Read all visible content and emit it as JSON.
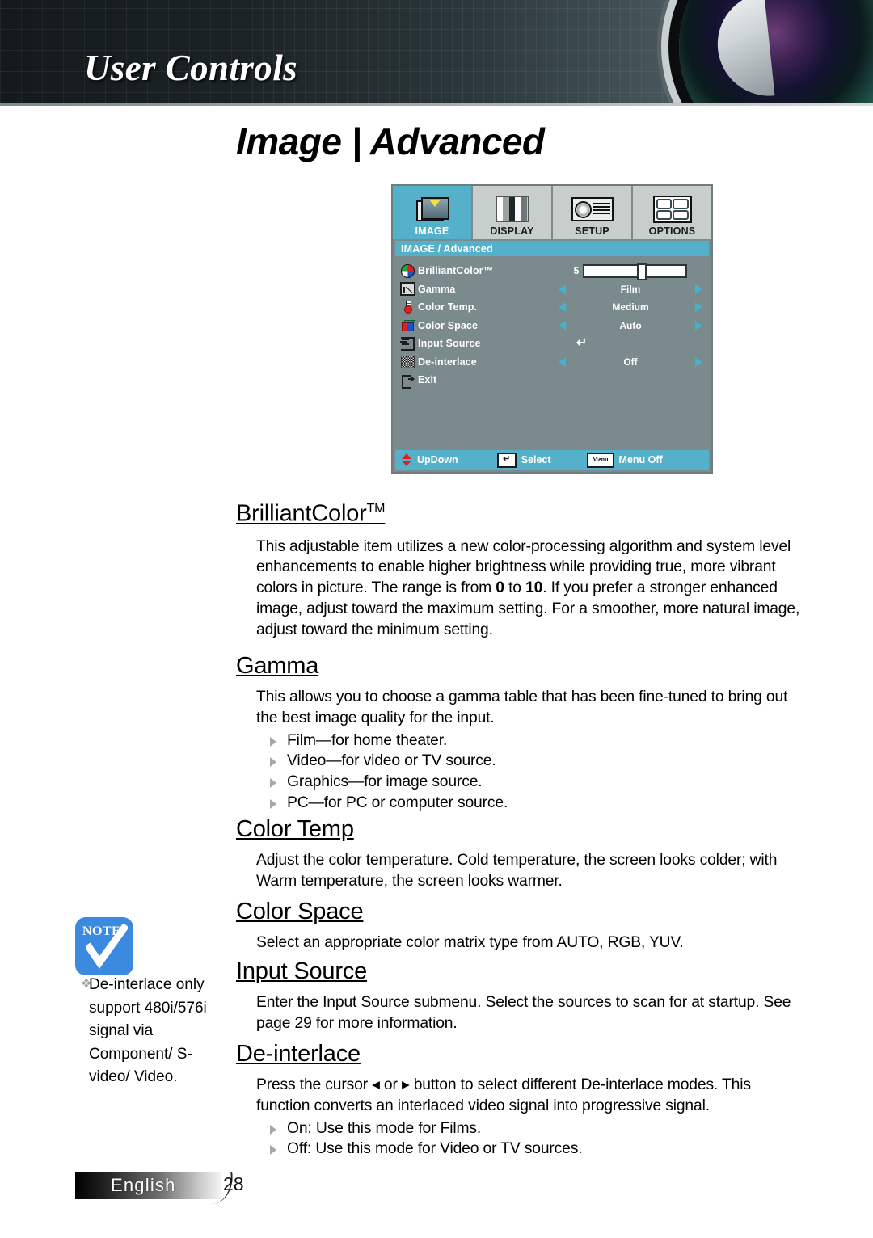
{
  "banner": {
    "title": "User Controls"
  },
  "page": {
    "title": "Image | Advanced"
  },
  "osd": {
    "tabs": [
      {
        "label": "IMAGE",
        "icon": "image-icon",
        "active": true
      },
      {
        "label": "DISPLAY",
        "icon": "display-icon",
        "active": false
      },
      {
        "label": "SETUP",
        "icon": "setup-icon",
        "active": false
      },
      {
        "label": "OPTIONS",
        "icon": "options-icon",
        "active": false
      }
    ],
    "breadcrumb": "IMAGE / Advanced",
    "rows": [
      {
        "label": "BrilliantColor™",
        "icon": "color-wheel-icon",
        "type": "slider",
        "value": "5"
      },
      {
        "label": "Gamma",
        "icon": "gamma-curve-icon",
        "type": "select",
        "value": "Film"
      },
      {
        "label": "Color Temp.",
        "icon": "thermometer-icon",
        "type": "select",
        "value": "Medium"
      },
      {
        "label": "Color Space",
        "icon": "rgb-cube-icon",
        "type": "select",
        "value": "Auto"
      },
      {
        "label": "Input Source",
        "icon": "input-arrow-icon",
        "type": "enter",
        "value": "↵"
      },
      {
        "label": "De-interlace",
        "icon": "dither-icon",
        "type": "select",
        "value": "Off"
      },
      {
        "label": "Exit",
        "icon": "exit-icon",
        "type": "none",
        "value": ""
      }
    ],
    "bottom_bar": {
      "updown_label": "UpDown",
      "select_label": "Select",
      "select_key": "↵",
      "menu_label": "Menu Off",
      "menu_key": "Menu"
    },
    "colors": {
      "accent": "#55b0c9",
      "panel": "#7b8a8d",
      "tab": "#c8cecb"
    }
  },
  "sections": {
    "brilliantcolor": {
      "heading": "BrilliantColor",
      "heading_sup": "TM",
      "body_pre": "This adjustable item utilizes a new color-processing algorithm and system level enhancements to enable higher brightness while providing true, more vibrant colors in picture. The range is from ",
      "range_min": "0",
      "body_mid": " to ",
      "range_max": "10",
      "body_post": ". If you prefer a stronger enhanced image, adjust toward the maximum setting. For a smoother, more natural image, adjust toward the minimum setting."
    },
    "gamma": {
      "heading": "Gamma",
      "body": "This allows you to choose a gamma table that has been fine-tuned to bring out the best image quality for the input.",
      "bullets": [
        "Film—for home theater.",
        "Video—for video or TV source.",
        "Graphics—for image source.",
        "PC—for PC or computer source."
      ]
    },
    "color_temp": {
      "heading": "Color Temp",
      "body": "Adjust the color temperature. Cold temperature, the screen looks colder; with Warm temperature, the screen looks warmer."
    },
    "color_space": {
      "heading": "Color Space",
      "body": "Select an appropriate color matrix type from AUTO, RGB, YUV."
    },
    "input_source": {
      "heading": "Input Source",
      "body": "Enter the Input Source submenu. Select the sources to scan for at startup. See page 29 for more information."
    },
    "de_interlace": {
      "heading": "De-interlace",
      "body": "Press the cursor ◂ or ▸ button to select different De-interlace modes. This function converts an interlaced video signal into progressive signal.",
      "bullets": [
        "On: Use this mode for Films.",
        "Off: Use this mode for Video or TV sources."
      ]
    }
  },
  "note": {
    "badge_label": "NOTE",
    "bullet": "❖",
    "text": "De-interlace only support 480i/576i signal via Component/ S-video/ Video."
  },
  "footer": {
    "language": "English",
    "page_number": "28"
  }
}
